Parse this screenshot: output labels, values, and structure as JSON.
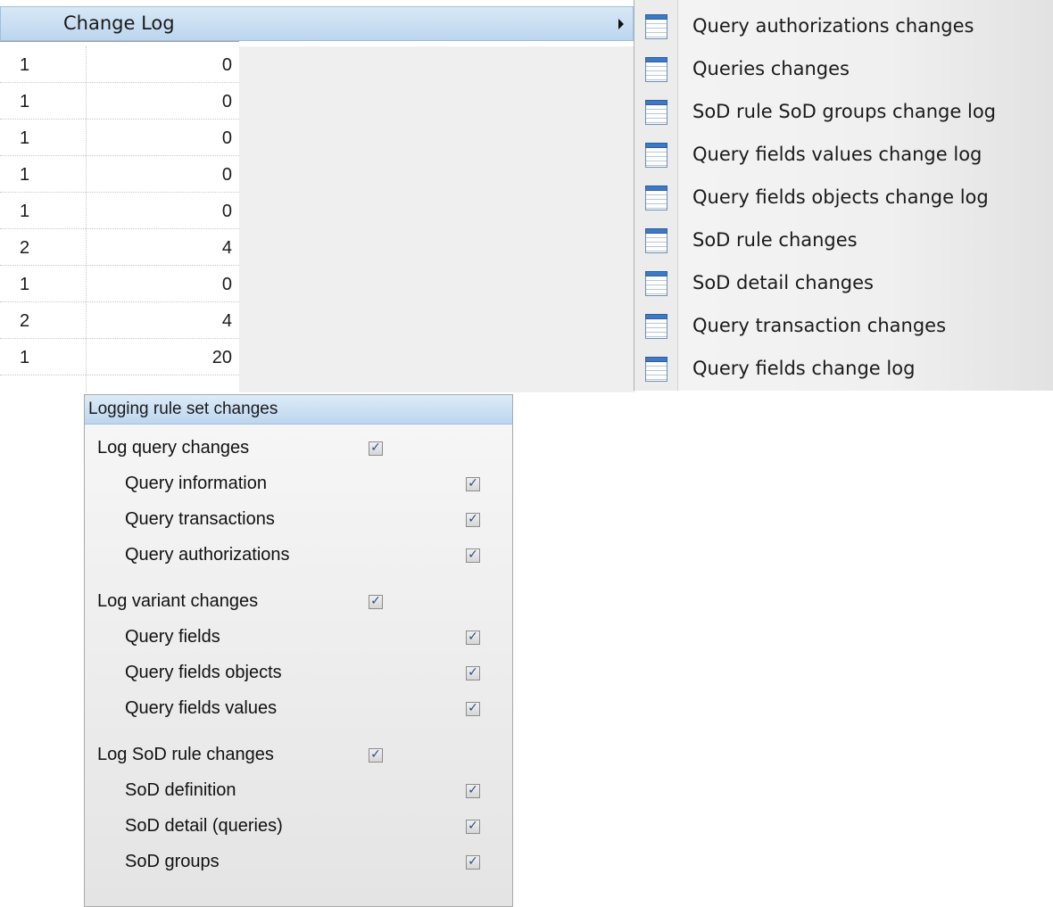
{
  "menu": {
    "label": "Change Log"
  },
  "grid": {
    "rows": [
      {
        "c1": "1",
        "c2": "0"
      },
      {
        "c1": "1",
        "c2": "0"
      },
      {
        "c1": "1",
        "c2": "0"
      },
      {
        "c1": "1",
        "c2": "0"
      },
      {
        "c1": "1",
        "c2": "0"
      },
      {
        "c1": "2",
        "c2": "4"
      },
      {
        "c1": "1",
        "c2": "0"
      },
      {
        "c1": "2",
        "c2": "4"
      },
      {
        "c1": "1",
        "c2": "20"
      }
    ]
  },
  "submenu": {
    "items": [
      {
        "label": "Query authorizations changes"
      },
      {
        "label": "Queries changes"
      },
      {
        "label": "SoD rule SoD groups change log"
      },
      {
        "label": "Query fields values change log"
      },
      {
        "label": "Query fields objects change log"
      },
      {
        "label": "SoD rule changes"
      },
      {
        "label": "SoD detail changes"
      },
      {
        "label": "Query transaction changes"
      },
      {
        "label": "Query fields change log"
      }
    ]
  },
  "panel": {
    "title": "Logging rule set changes",
    "check_glyph": "✓",
    "groups": [
      {
        "label": "Log query changes",
        "checked": true,
        "items": [
          {
            "label": "Query information",
            "checked": true
          },
          {
            "label": "Query transactions",
            "checked": true
          },
          {
            "label": "Query authorizations",
            "checked": true
          }
        ]
      },
      {
        "label": "Log variant changes",
        "checked": true,
        "items": [
          {
            "label": "Query fields",
            "checked": true
          },
          {
            "label": "Query fields objects",
            "checked": true
          },
          {
            "label": "Query fields values",
            "checked": true
          }
        ]
      },
      {
        "label": "Log SoD rule changes",
        "checked": true,
        "items": [
          {
            "label": "SoD definition",
            "checked": true
          },
          {
            "label": "SoD detail (queries)",
            "checked": true
          },
          {
            "label": "SoD groups",
            "checked": true
          }
        ]
      }
    ]
  }
}
